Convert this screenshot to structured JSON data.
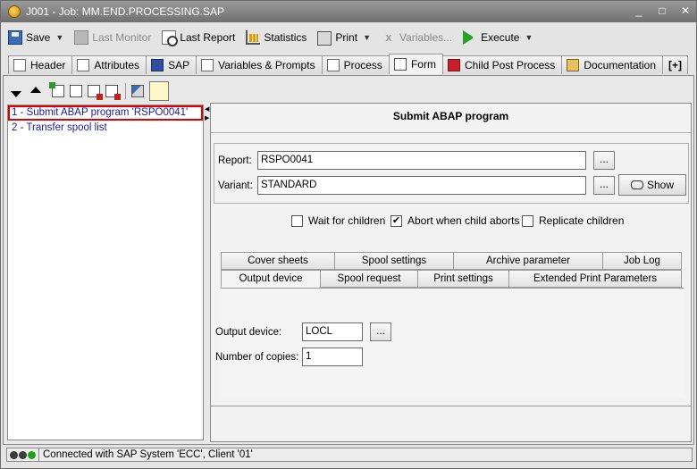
{
  "window": {
    "title": "J001 - Job: MM.END.PROCESSING.SAP",
    "controls": [
      "_",
      "□",
      "✕"
    ]
  },
  "toolbar": {
    "save": "Save",
    "last_monitor": "Last Monitor",
    "last_report": "Last Report",
    "statistics": "Statistics",
    "print": "Print",
    "variables": "Variables...",
    "execute": "Execute"
  },
  "tabs": [
    {
      "label": "Header",
      "icon": "header-icon"
    },
    {
      "label": "Attributes",
      "icon": "attributes-icon"
    },
    {
      "label": "SAP",
      "icon": "sap-icon"
    },
    {
      "label": "Variables & Prompts",
      "icon": "variables-icon"
    },
    {
      "label": "Process",
      "icon": "process-icon"
    },
    {
      "label": "Form",
      "icon": "form-icon",
      "active": true
    },
    {
      "label": "Child Post Process",
      "icon": "child-post-process-icon"
    },
    {
      "label": "Documentation",
      "icon": "documentation-icon"
    },
    {
      "label": "[+]",
      "icon": "add-tab-icon"
    }
  ],
  "tree": {
    "items": [
      {
        "label": "1 - Submit ABAP program 'RSPO0041'",
        "selected": true
      },
      {
        "label": "2 - Transfer spool list",
        "selected": false
      }
    ]
  },
  "form": {
    "title": "Submit ABAP program",
    "report_label": "Report:",
    "report_value": "RSPO0041",
    "variant_label": "Variant:",
    "variant_value": "STANDARD",
    "ellipsis": "...",
    "show_label": "Show",
    "checks": [
      {
        "label": "Wait for children",
        "checked": false
      },
      {
        "label": "Abort when child aborts",
        "checked": true
      },
      {
        "label": "Replicate children",
        "checked": false
      }
    ],
    "subtabs_row1": [
      "Cover sheets",
      "Spool settings",
      "Archive parameter",
      "Job Log"
    ],
    "subtabs_row2": [
      "Output device",
      "Spool request",
      "Print settings",
      "Extended Print Parameters"
    ],
    "active_subtab": "Output device",
    "output_device_label": "Output device:",
    "output_device_value": "LOCL",
    "copies_label": "Number of copies:",
    "copies_value": "1"
  },
  "status": {
    "text": "Connected with SAP System 'ECC', Client '01'",
    "leds": [
      "#3c3c3c",
      "#3c3c3c",
      "#1ea01e"
    ]
  }
}
